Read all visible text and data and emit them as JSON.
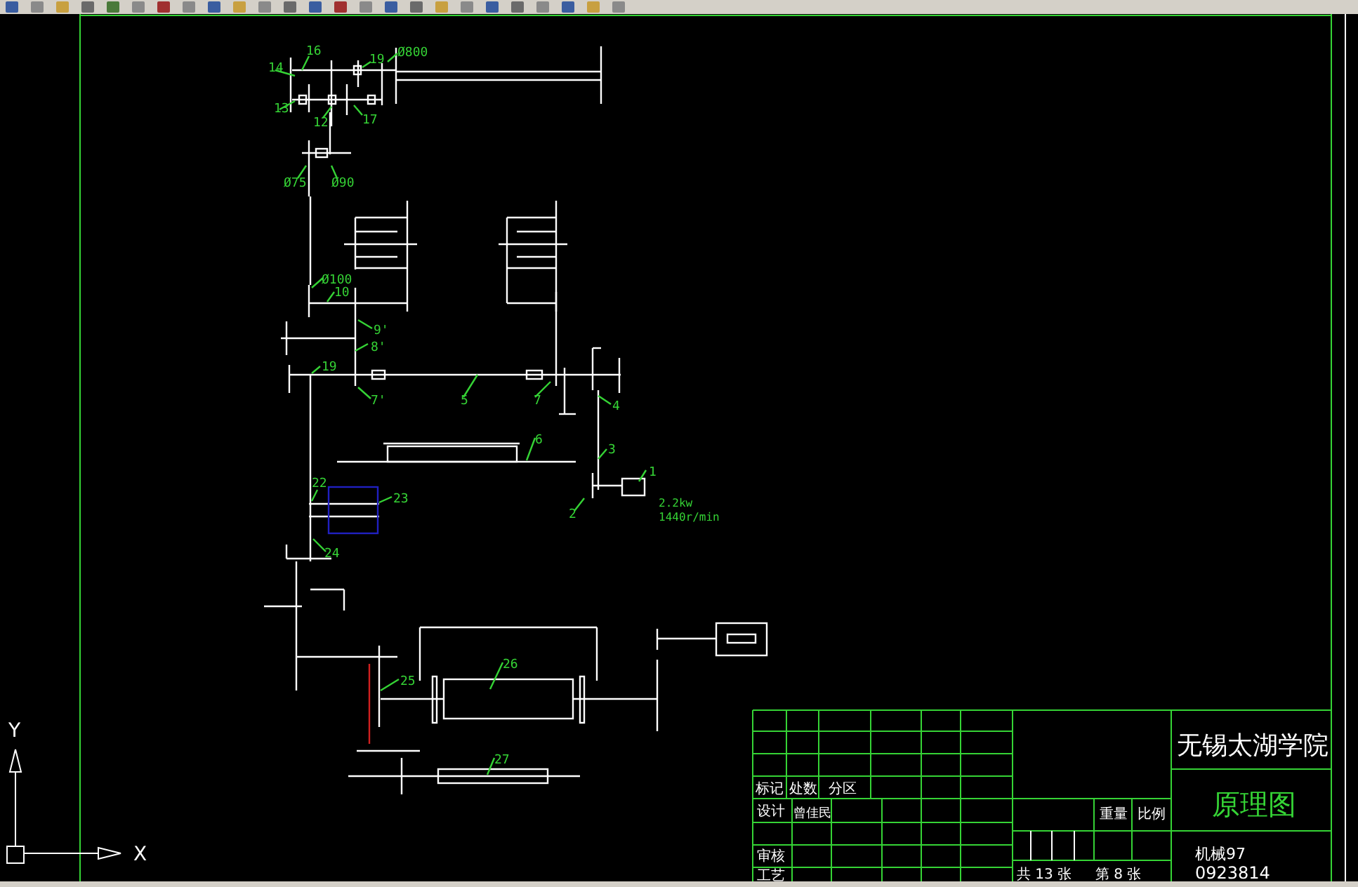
{
  "drawing": {
    "callouts": [
      "Ø800",
      "14",
      "16",
      "13",
      "12",
      "19",
      "17",
      "Ø75",
      "Ø90",
      "Ø100",
      "10",
      "9'",
      "8'",
      "19",
      "7'",
      "5",
      "7",
      "4",
      "3",
      "6",
      "1",
      "2",
      "22",
      "23",
      "24",
      "25",
      "26",
      "27"
    ],
    "motor": {
      "power": "2.2kw",
      "speed": "1440r/min"
    }
  },
  "title_block": {
    "school": "无锡太湖学院",
    "drawing_name": "原理图",
    "header_labels": [
      "标记",
      "处数",
      "分区"
    ],
    "signature_labels": [
      "设计",
      "审核",
      "工艺"
    ],
    "designer": "曾佳民",
    "weight_label": "重量",
    "scale_label": "比例",
    "sheet_total": "共 13 张",
    "sheet_number": "第 8 张",
    "class": "机械97",
    "student_id": "0923814"
  },
  "ucs": {
    "x_label": "X",
    "y_label": "Y"
  }
}
